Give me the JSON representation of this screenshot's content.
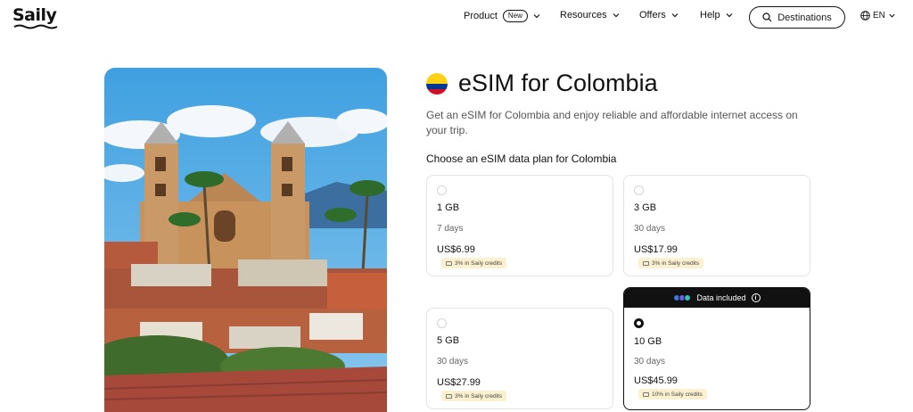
{
  "header": {
    "logo": "Saily",
    "nav": [
      {
        "label": "Product",
        "badge": "New"
      },
      {
        "label": "Resources"
      },
      {
        "label": "Offers"
      },
      {
        "label": "Help"
      }
    ],
    "destinations_label": "Destinations",
    "language": "EN"
  },
  "page": {
    "title": "eSIM for Colombia",
    "subtitle": "Get an eSIM for Colombia and enjoy reliable and affordable internet access on your trip.",
    "choose_label": "Choose an eSIM data plan for Colombia"
  },
  "flag_colors": [
    "#fcd116",
    "#003893",
    "#ce1126"
  ],
  "plans": [
    {
      "data": "1 GB",
      "duration": "7 days",
      "price": "US$6.99",
      "credits": "3% in Saily credits",
      "selected": false
    },
    {
      "data": "3 GB",
      "duration": "30 days",
      "price": "US$17.99",
      "credits": "3% in Saily credits",
      "selected": false
    },
    {
      "data": "5 GB",
      "duration": "30 days",
      "price": "US$27.99",
      "credits": "3% in Saily credits",
      "selected": false
    },
    {
      "data": "10 GB",
      "duration": "30 days",
      "price": "US$45.99",
      "credits": "10% in Saily credits",
      "selected": true,
      "banner": "Data included"
    }
  ],
  "icons": {
    "chevron": "chevron-down-icon",
    "search": "search-icon",
    "globe": "globe-icon",
    "info": "info-icon",
    "wallet": "wallet-icon"
  }
}
